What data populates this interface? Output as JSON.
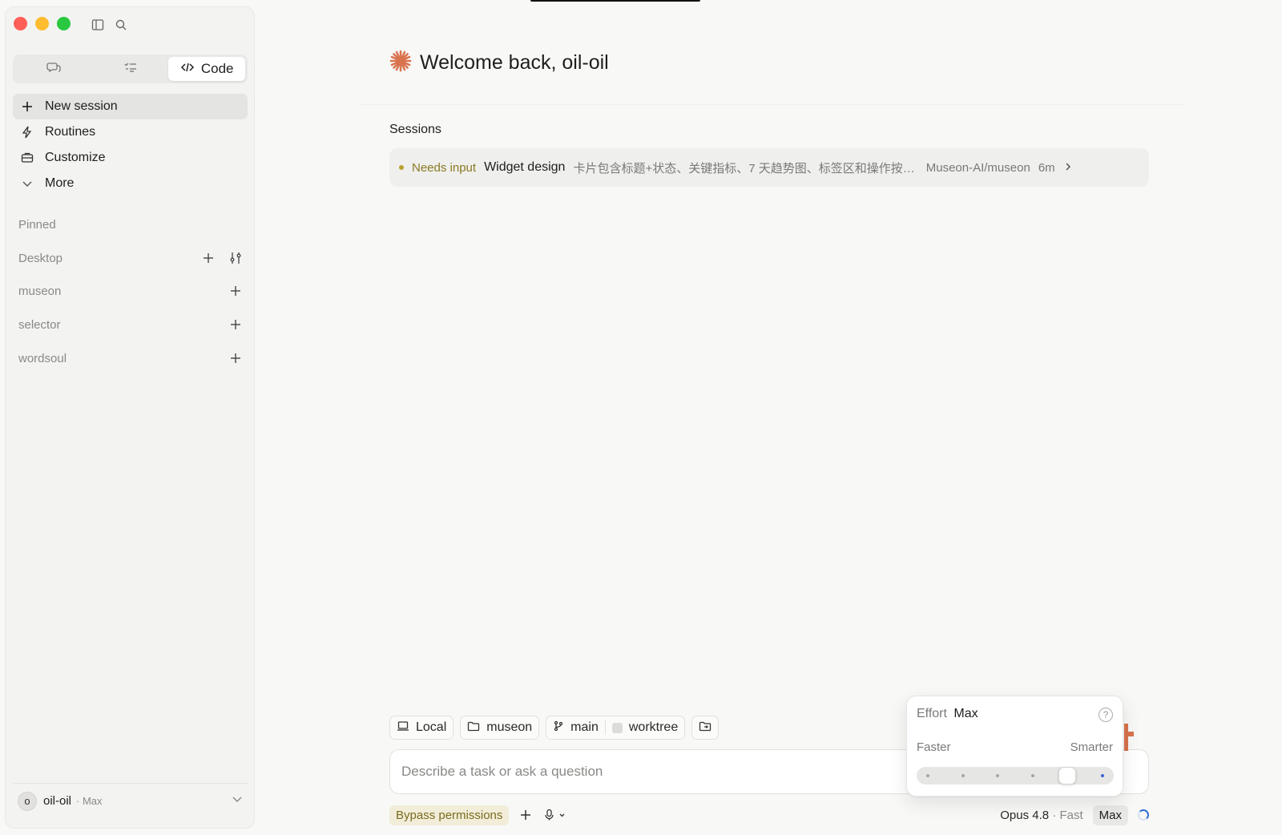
{
  "sidebar": {
    "tabs": [
      {
        "name": "chat",
        "icon": "chat-bubbles-icon",
        "label": ""
      },
      {
        "name": "tasks",
        "icon": "checklist-icon",
        "label": ""
      },
      {
        "name": "code",
        "icon": "code-icon",
        "label": "Code"
      }
    ],
    "nav": [
      {
        "icon": "plus-icon",
        "label": "New session"
      },
      {
        "icon": "lightning-icon",
        "label": "Routines"
      },
      {
        "icon": "briefcase-icon",
        "label": "Customize"
      },
      {
        "icon": "chevron-down-icon",
        "label": "More"
      }
    ],
    "pinned_label": "Pinned",
    "projects": [
      {
        "label": "Desktop"
      },
      {
        "label": "museon"
      },
      {
        "label": "selector"
      },
      {
        "label": "wordsoul"
      }
    ],
    "user": {
      "initial": "o",
      "name": "oil-oil",
      "plan": "· Max"
    }
  },
  "main": {
    "greeting": "Welcome back, oil-oil",
    "sessions_title": "Sessions",
    "sessions": [
      {
        "status": "Needs input",
        "name": "Widget design",
        "description": "卡片包含标题+状态、关键指标、7 天趋势图、标签区和操作按…",
        "repo": "Museon-AI/museon",
        "time": "6m"
      }
    ]
  },
  "composer": {
    "chips": {
      "local": "Local",
      "folder": "museon",
      "branch": "main",
      "worktree": "worktree"
    },
    "placeholder": "Describe a task or ask a question",
    "bypass": "Bypass permissions",
    "model": "Opus 4.8",
    "model_speed": "· Fast",
    "effort_badge": "Max"
  },
  "effort_popover": {
    "label": "Effort",
    "value": "Max",
    "left_label": "Faster",
    "right_label": "Smarter",
    "levels": 6,
    "selected_level_fraction": 0.8
  },
  "colors": {
    "accent": "#d9734e",
    "status": "#b8a230",
    "link_blue": "#3b63d6"
  }
}
